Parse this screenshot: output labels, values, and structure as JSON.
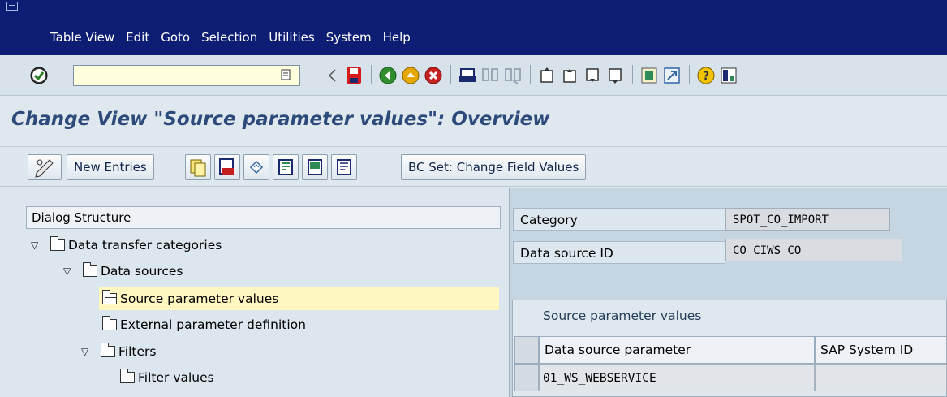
{
  "menu": {
    "items": [
      {
        "label": "Table View"
      },
      {
        "label": "Edit"
      },
      {
        "label": "Goto"
      },
      {
        "label": "Selection"
      },
      {
        "label": "Utilities"
      },
      {
        "label": "System"
      },
      {
        "label": "Help"
      }
    ]
  },
  "toolbar": {
    "command_value": "",
    "icons": [
      "enter-icon",
      "back-icon",
      "save-icon",
      "back-nav-icon",
      "exit-icon",
      "cancel-icon",
      "print-icon",
      "find-icon",
      "find-next-icon",
      "first-page-icon",
      "prev-page-icon",
      "next-page-icon",
      "last-page-icon",
      "create-session-icon",
      "shortcut-icon",
      "help-icon",
      "layout-icon"
    ]
  },
  "title": "Change View \"Source parameter values\": Overview",
  "app_toolbar": {
    "new_entries": "New Entries",
    "bc_set": "BC Set: Change Field Values"
  },
  "dialog_structure": {
    "header": "Dialog Structure",
    "items": [
      {
        "label": "Data transfer categories"
      },
      {
        "label": "Data sources"
      },
      {
        "label": "Source parameter values"
      },
      {
        "label": "External parameter definition"
      },
      {
        "label": "Filters"
      },
      {
        "label": "Filter values"
      }
    ]
  },
  "fields": {
    "category_label": "Category",
    "category_value": "SPOT_CO_IMPORT",
    "datasource_label": "Data source ID",
    "datasource_value": "CO_CIWS_CO"
  },
  "table": {
    "title": "Source parameter values",
    "columns": [
      "Data source parameter",
      "SAP System ID"
    ],
    "rows": [
      [
        "01_WS_WEBSERVICE",
        ""
      ]
    ]
  },
  "colors": {
    "menubar": "#0c1d73",
    "title": "#2d4a7a",
    "selected_row": "#fff6c0",
    "command_field": "#ffffde"
  }
}
